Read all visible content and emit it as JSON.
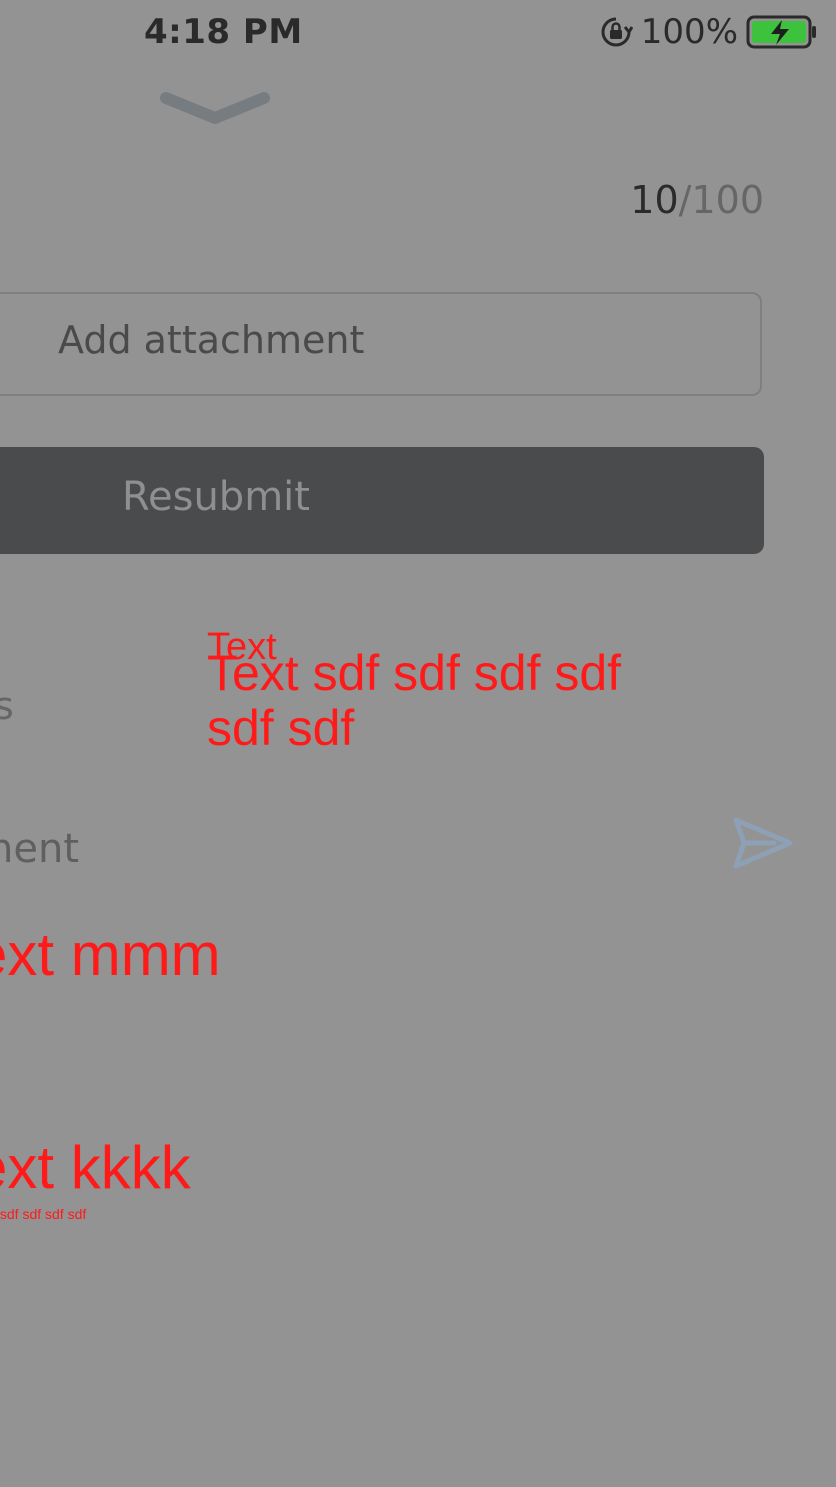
{
  "status_bar": {
    "time": "4:18 PM",
    "battery": "100%"
  },
  "counter": {
    "current": "10",
    "separator_max": "/100"
  },
  "attachment": {
    "label": "Add attachment"
  },
  "resubmit": {
    "label": "Resubmit"
  },
  "overlay": {
    "small_title": "Text",
    "body": "Text sdf sdf sdf sdf sdf sdf",
    "line_mmm": "ext mmm",
    "line_kkkk": "ext kkkk",
    "tiny": "tsdf sdf sdf sdf"
  },
  "partial": {
    "left_s": "s",
    "left_ment": "nent"
  },
  "icons": {
    "send": "send-icon",
    "chevron": "chevron-down-icon",
    "lock": "rotation-lock-icon",
    "battery": "battery-charging-icon"
  },
  "colors": {
    "overlay_red": "#ff1a1a",
    "button_bg": "#4a4b4d",
    "battery_fill": "#3cc23c"
  }
}
